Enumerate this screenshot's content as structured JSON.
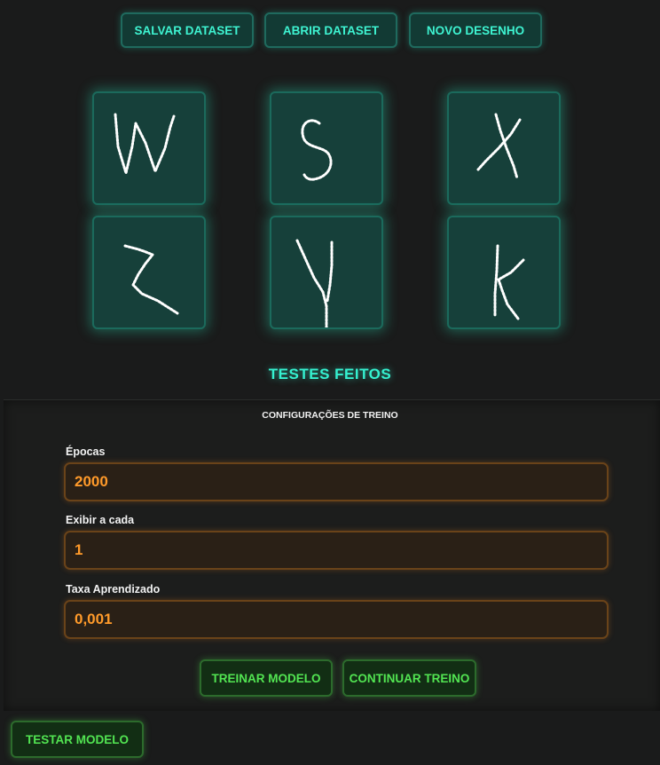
{
  "toolbar": {
    "save_label": "SALVAR DATASET",
    "open_label": "ABRIR DATASET",
    "new_label": "NOVO DESENHO"
  },
  "samples": [
    {
      "letter": "W"
    },
    {
      "letter": "S"
    },
    {
      "letter": "X"
    },
    {
      "letter": "Z"
    },
    {
      "letter": "Y"
    },
    {
      "letter": "K"
    }
  ],
  "tests": {
    "title": "TESTES FEITOS"
  },
  "training": {
    "title": "CONFIGURAÇÕES DE TREINO",
    "epochs_label": "Épocas",
    "epochs_value": "2000",
    "display_label": "Exibir a cada",
    "display_value": "1",
    "rate_label": "Taxa Aprendizado",
    "rate_value": "0,001",
    "train_label": "TREINAR MODELO",
    "continue_label": "CONTINUAR TREINO"
  },
  "test_button": {
    "label": "TESTAR MODELO"
  },
  "colors": {
    "teal_accent": "#3ef3d1",
    "orange_accent": "#ff9a2a",
    "green_accent": "#52e552"
  }
}
